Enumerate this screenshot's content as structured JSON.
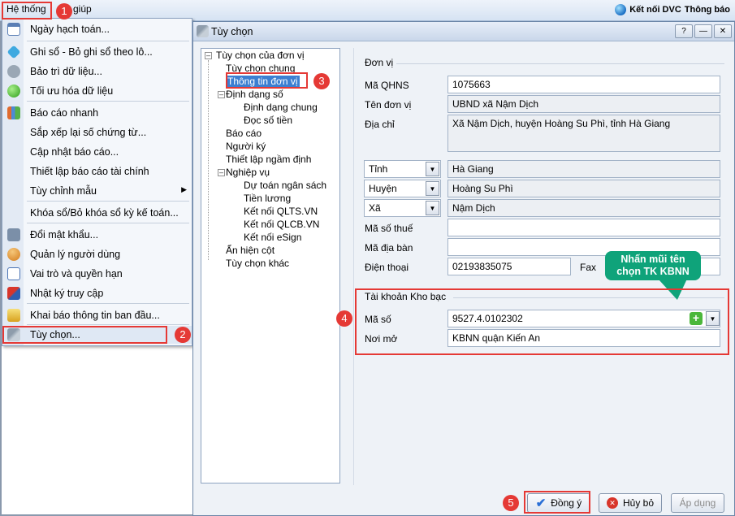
{
  "menubar": {
    "he_thong": "Hệ thống",
    "tro_giup": "giúp",
    "ket_noi": "Kết nối DVC",
    "thong_bao": "Thông báo"
  },
  "menu": {
    "items": [
      {
        "label": "Ngày hạch toán...",
        "icon": "calendar-icon"
      },
      {
        "label": "Ghi sổ - Bỏ ghi sổ theo lô...",
        "icon": "post-batch-icon"
      },
      {
        "label": "Bảo trì dữ liệu...",
        "icon": "maintenance-icon"
      },
      {
        "label": "Tối ưu hóa dữ liệu",
        "icon": "optimize-icon"
      },
      {
        "label": "Báo cáo nhanh",
        "icon": "report-icon"
      },
      {
        "label": "Sắp xếp lại số chứng từ...",
        "icon": ""
      },
      {
        "label": "Cập nhật báo cáo...",
        "icon": ""
      },
      {
        "label": "Thiết lập báo cáo tài chính",
        "icon": ""
      },
      {
        "label": "Tùy chỉnh mẫu",
        "icon": ""
      },
      {
        "label": "Khóa sổ/Bỏ khóa sổ kỳ kế toán...",
        "icon": ""
      },
      {
        "label": "Đổi mật khẩu...",
        "icon": "password-icon"
      },
      {
        "label": "Quản lý người dùng",
        "icon": "users-icon"
      },
      {
        "label": "Vai trò và quyền hạn",
        "icon": "roles-icon"
      },
      {
        "label": "Nhật ký truy cập",
        "icon": "log-icon"
      },
      {
        "label": "Khai báo thông tin ban đầu...",
        "icon": "setup-icon"
      },
      {
        "label": "Tùy chọn...",
        "icon": "options-icon"
      }
    ]
  },
  "dialog": {
    "title": "Tùy chọn",
    "tree": [
      "Tùy chọn của đơn vị",
      "Tùy chọn chung",
      "Thông tin đơn vị",
      "Định dạng số",
      "Định dạng chung",
      "Đọc số tiền",
      "Báo cáo",
      "Người ký",
      "Thiết lập ngầm định",
      "Nghiệp vụ",
      "Dự toán ngân sách",
      "Tiền lương",
      "Kết nối QLTS.VN",
      "Kết nối QLCB.VN",
      "Kết nối eSign",
      "Ẩn hiện cột",
      "Tùy chọn khác"
    ],
    "group_don_vi": "Đơn vị",
    "ma_qhns_label": "Mã QHNS",
    "ma_qhns": "1075663",
    "ten_don_vi_label": "Tên đơn vị",
    "ten_don_vi": "UBND xã Nậm Dịch",
    "dia_chi_label": "Địa chỉ",
    "dia_chi": "Xã Nậm Dịch, huyện Hoàng Su Phì, tỉnh Hà Giang",
    "tinh_label": "Tỉnh",
    "tinh": "Hà Giang",
    "huyen_label": "Huyện",
    "huyen": "Hoàng Su Phì",
    "xa_label": "Xã",
    "xa": "Nậm Dịch",
    "ma_so_thue_label": "Mã số thuế",
    "ma_dia_ban_label": "Mã địa bàn",
    "dien_thoai_label": "Điện thoại",
    "dien_thoai": "02193835075",
    "fax_label": "Fax",
    "group_kho_bac": "Tài khoản Kho bạc",
    "ma_so_label": "Mã số",
    "ma_so": "9527.4.0102302",
    "noi_mo_label": "Nơi mở",
    "noi_mo": "KBNN quận Kiến An",
    "btn_dong_y": "Đồng ý",
    "btn_huy_bo": "Hủy bỏ",
    "btn_ap_dung": "Áp dụng"
  },
  "callout": {
    "line1": "Nhấn mũi tên",
    "line2": "chọn TK KBNN"
  },
  "steps": [
    "1",
    "2",
    "3",
    "4",
    "5"
  ],
  "colors": {
    "highlight": "#e53935",
    "callout": "#0fa37a"
  }
}
